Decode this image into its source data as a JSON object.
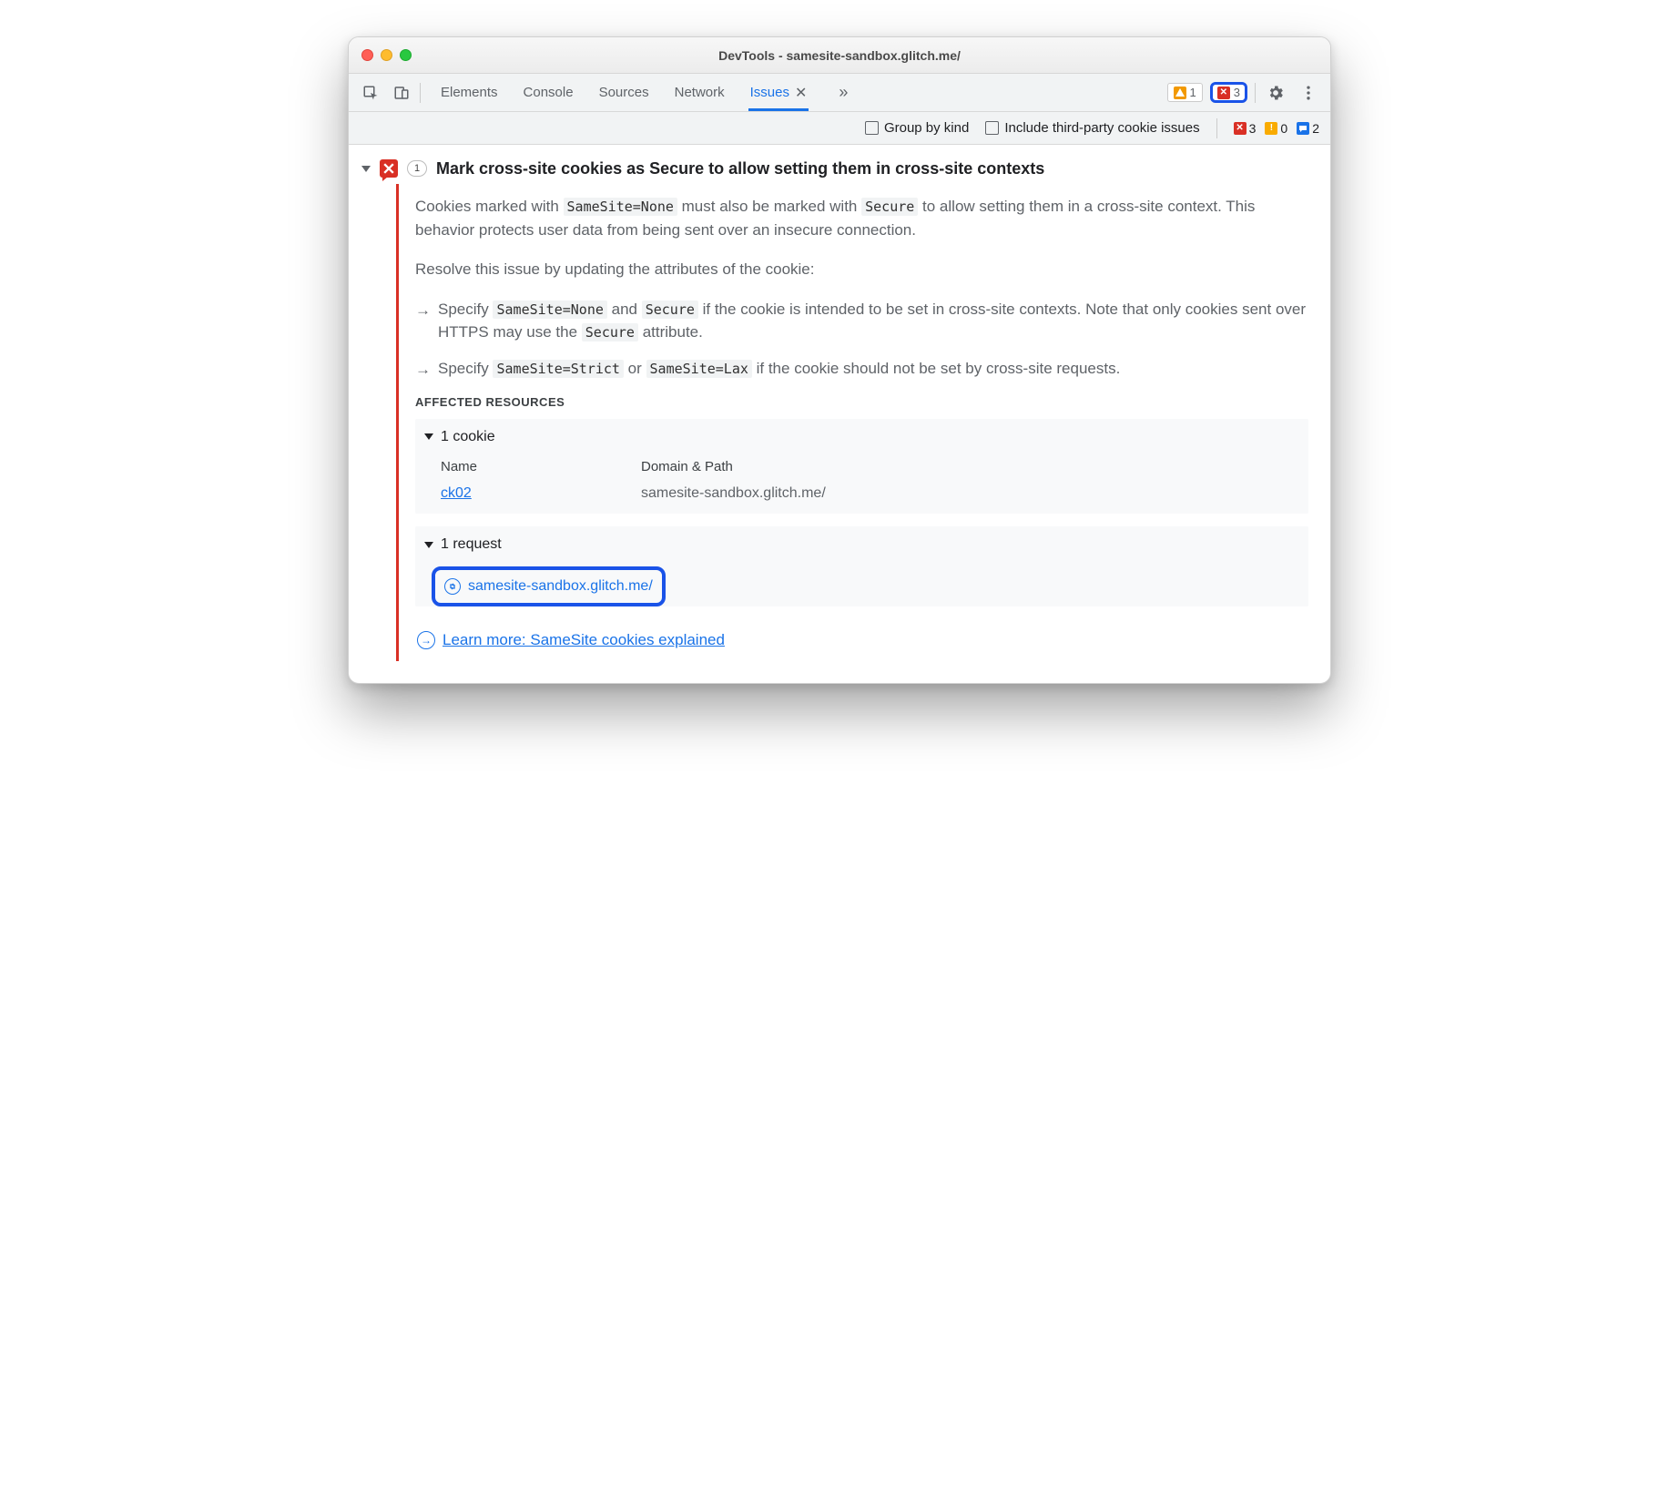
{
  "window": {
    "title": "DevTools - samesite-sandbox.glitch.me/"
  },
  "tabs": {
    "items": [
      "Elements",
      "Console",
      "Sources",
      "Network",
      "Issues"
    ],
    "active": "Issues"
  },
  "topbar_badges": {
    "warn_count": "1",
    "err_count": "3"
  },
  "optsbar": {
    "group_by_kind": "Group by kind",
    "third_party": "Include third-party cookie issues",
    "err": "3",
    "info": "0",
    "msg": "2"
  },
  "issue": {
    "count": "1",
    "title": "Mark cross-site cookies as Secure to allow setting them in cross-site contexts",
    "p1a": "Cookies marked with ",
    "c_ssnone": "SameSite=None",
    "p1b": " must also be marked with ",
    "c_secure": "Secure",
    "p1c": " to allow setting them in a cross-site context. This behavior protects user data from being sent over an insecure connection.",
    "p2": "Resolve this issue by updating the attributes of the cookie:",
    "b1a": "Specify ",
    "b1b": " and ",
    "b1c": " if the cookie is intended to be set in cross-site contexts. Note that only cookies sent over HTTPS may use the ",
    "b1d": " attribute.",
    "b2a": "Specify ",
    "c_ssstrict": "SameSite=Strict",
    "b2b": " or ",
    "c_sslax": "SameSite=Lax",
    "b2c": " if the cookie should not be set by cross-site requests.",
    "affected_h": "AFFECTED RESOURCES",
    "cookie_h": "1 cookie",
    "col_name": "Name",
    "col_domain": "Domain & Path",
    "cookie_name": "ck02",
    "cookie_domain": "samesite-sandbox.glitch.me/",
    "request_h": "1 request",
    "request_url": "samesite-sandbox.glitch.me/",
    "learn": "Learn more: SameSite cookies explained"
  }
}
